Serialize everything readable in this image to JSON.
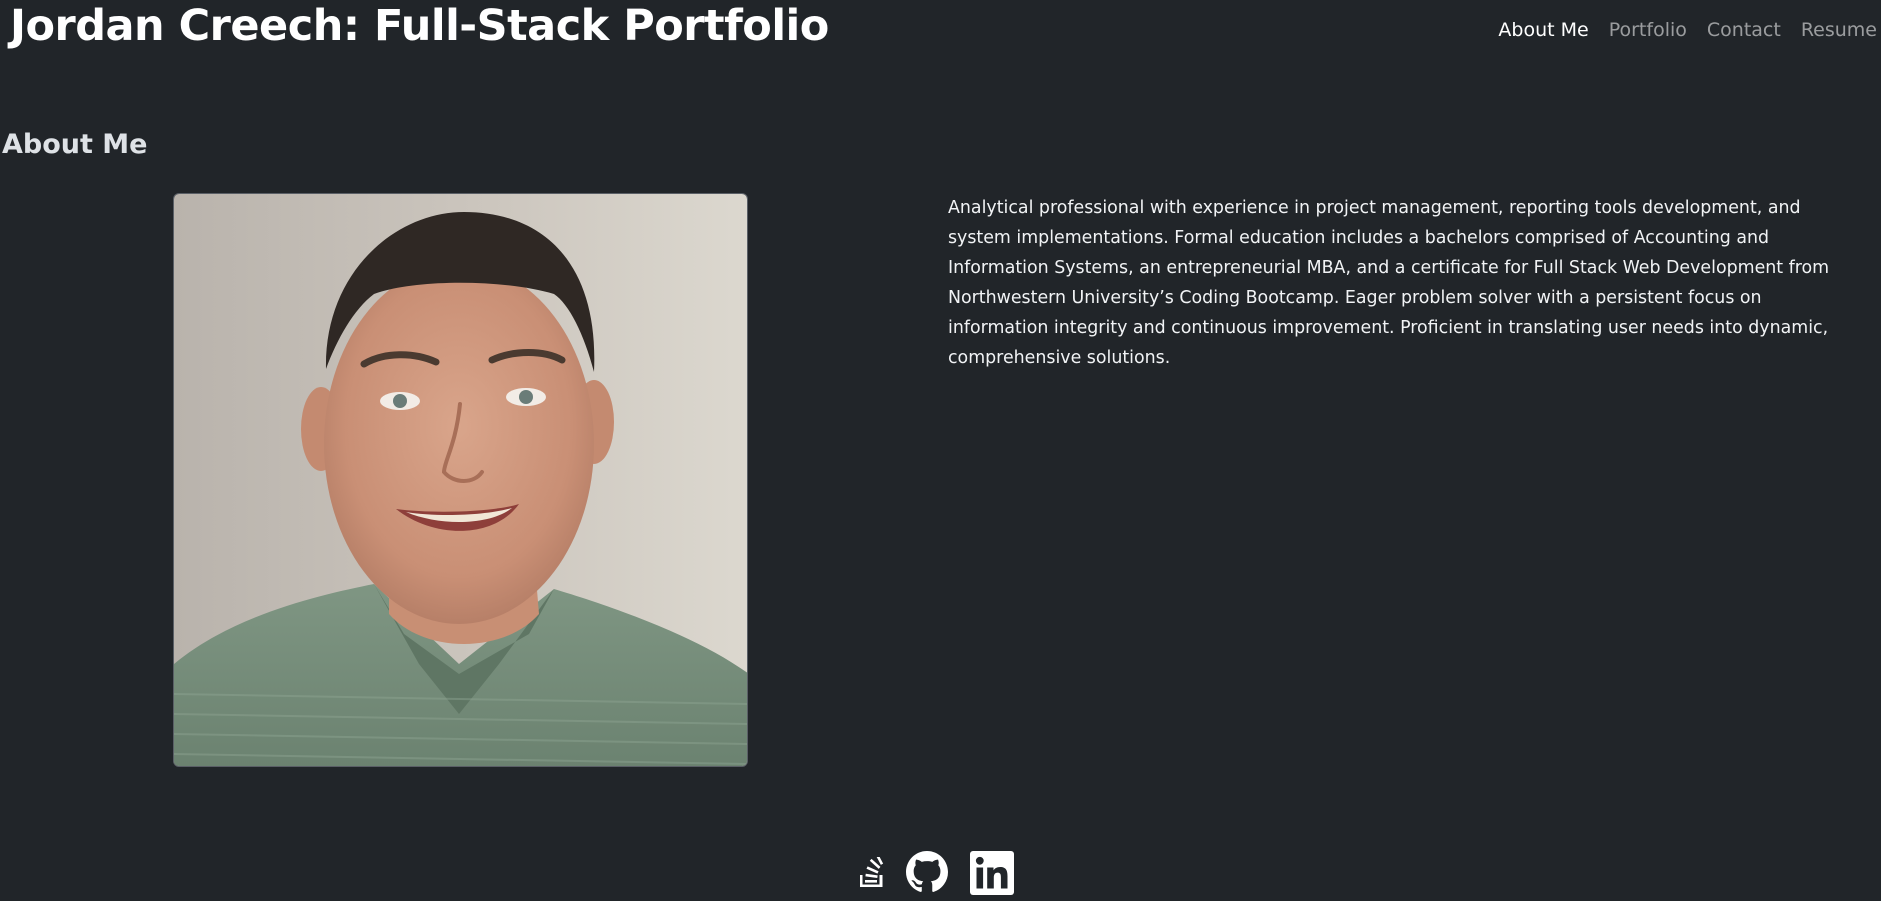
{
  "header": {
    "title": "Jordan Creech: Full-Stack Portfolio",
    "nav": [
      {
        "label": "About Me",
        "active": true
      },
      {
        "label": "Portfolio",
        "active": false
      },
      {
        "label": "Contact",
        "active": false
      },
      {
        "label": "Resume",
        "active": false
      }
    ]
  },
  "about": {
    "heading": "About Me",
    "photo_alt": "Jordan Creech headshot",
    "bio": "Analytical professional with experience in project management, reporting tools development, and system implementations. Formal education includes a bachelors comprised of Accounting and Information Systems, an entrepreneurial MBA, and a certificate for Full Stack Web Development from Northwestern University’s Coding Bootcamp. Eager problem solver with a persistent focus on information integrity and continuous improvement. Proficient in translating user needs into dynamic, comprehensive solutions."
  },
  "footer": {
    "socials": [
      {
        "icon": "stack-overflow-icon"
      },
      {
        "icon": "github-icon"
      },
      {
        "icon": "linkedin-icon"
      }
    ]
  },
  "colors": {
    "background": "#212529",
    "nav_active": "#ffffff",
    "nav_inactive": "#8c8f93",
    "heading": "#dee2e6"
  }
}
